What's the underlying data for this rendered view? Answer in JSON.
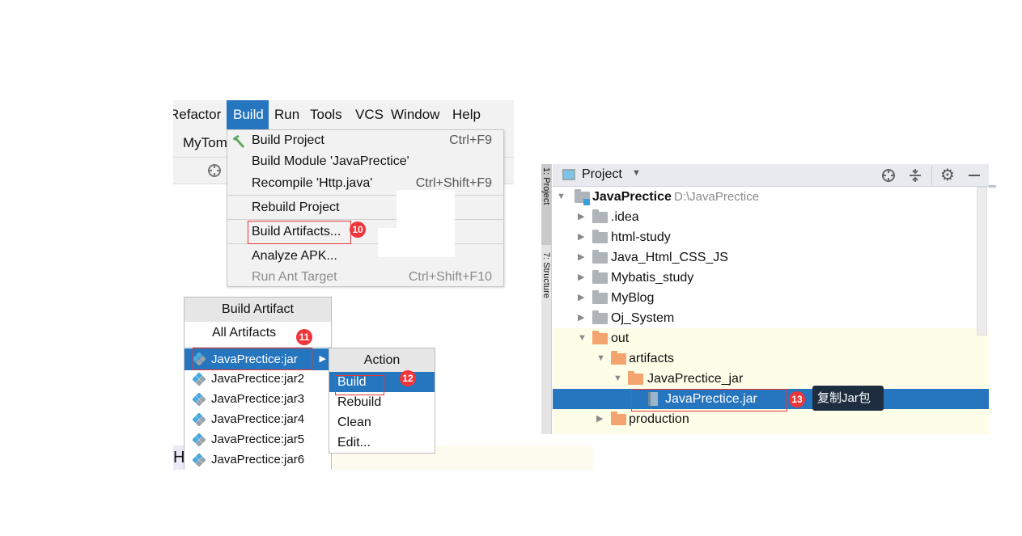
{
  "menubar": {
    "items": [
      {
        "label": "Refactor"
      },
      {
        "label": "Build",
        "active": true
      },
      {
        "label": "Run"
      },
      {
        "label": "Tools"
      },
      {
        "label": "VCS"
      },
      {
        "label": "Window"
      },
      {
        "label": "Help"
      }
    ]
  },
  "toolbar": {
    "run_config": "MyTom"
  },
  "build_menu": {
    "items": [
      {
        "label": "Build Project",
        "shortcut": "Ctrl+F9",
        "icon": "hammer-icon"
      },
      {
        "label": "Build Module 'JavaPrectice'",
        "shortcut": ""
      },
      {
        "label": "Recompile 'Http.java'",
        "shortcut": "Ctrl+Shift+F9"
      },
      {
        "label": "Rebuild Project",
        "shortcut": ""
      },
      {
        "label": "Build Artifacts...",
        "shortcut": ""
      },
      {
        "label": "Analyze APK...",
        "shortcut": ""
      },
      {
        "label": "Run Ant Target",
        "shortcut": "Ctrl+Shift+F10",
        "disabled": true
      }
    ]
  },
  "artifact_popup": {
    "title": "Build Artifact",
    "all": "All Artifacts",
    "items": [
      "JavaPrectice:jar",
      "JavaPrectice:jar2",
      "JavaPrectice:jar3",
      "JavaPrectice:jar4",
      "JavaPrectice:jar5",
      "JavaPrectice:jar6"
    ],
    "selected": "JavaPrectice:jar"
  },
  "action_popup": {
    "title": "Action",
    "items": [
      "Build",
      "Rebuild",
      "Clean",
      "Edit..."
    ],
    "selected": "Build"
  },
  "editor": {
    "fragment": "H"
  },
  "badges": {
    "b10": "10",
    "b11": "11",
    "b12": "12",
    "b13": "13"
  },
  "project_panel": {
    "title": "Project",
    "side_tabs": [
      "1: Project",
      "7: Structure"
    ],
    "root": {
      "name": "JavaPrectice",
      "path": "D:\\JavaPrectice"
    },
    "tree": [
      {
        "name": ".idea",
        "level": 1,
        "expanded": false,
        "type": "folder"
      },
      {
        "name": "html-study",
        "level": 1,
        "expanded": false,
        "type": "folder"
      },
      {
        "name": "Java_Html_CSS_JS",
        "level": 1,
        "expanded": false,
        "type": "folder"
      },
      {
        "name": "Mybatis_study",
        "level": 1,
        "expanded": false,
        "type": "folder"
      },
      {
        "name": "MyBlog",
        "level": 1,
        "expanded": false,
        "type": "folder"
      },
      {
        "name": "Oj_System",
        "level": 1,
        "expanded": false,
        "type": "folder"
      },
      {
        "name": "out",
        "level": 1,
        "expanded": true,
        "type": "excluded-folder"
      },
      {
        "name": "artifacts",
        "level": 2,
        "expanded": true,
        "type": "excluded-folder"
      },
      {
        "name": "JavaPrectice_jar",
        "level": 3,
        "expanded": true,
        "type": "excluded-folder"
      },
      {
        "name": "JavaPrectice.jar",
        "level": 4,
        "type": "jar",
        "selected": true
      },
      {
        "name": "production",
        "level": 2,
        "expanded": false,
        "type": "excluded-folder"
      }
    ],
    "tooltip": "复制Jar包"
  },
  "colors": {
    "accent": "#2675bf",
    "badge": "#f0353a",
    "highlight_box": "#e53935",
    "excluded_bg": "#fefde8",
    "tooltip_bg": "#1e2e40"
  }
}
